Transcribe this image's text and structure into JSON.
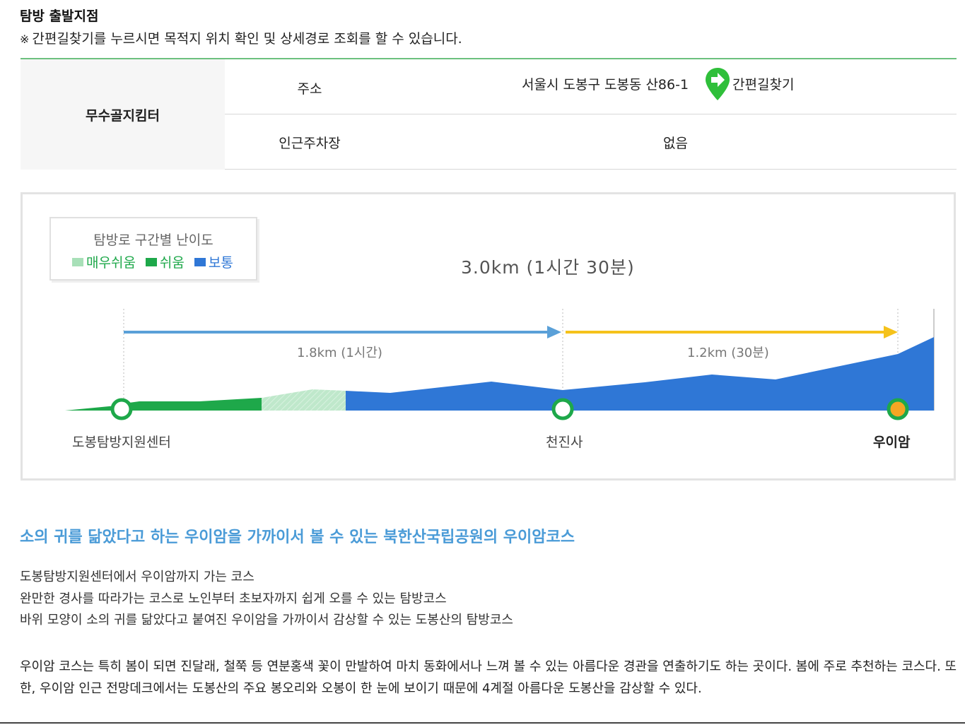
{
  "section": {
    "title": "탐방 출발지점",
    "note_mark": "※",
    "note": "간편길찾기를 누르시면 목적지 위치 확인 및 상세경로 조회를 할 수 있습니다."
  },
  "info_table": {
    "head": "무수골지킴터",
    "rows": [
      {
        "label": "주소",
        "value": "서울시 도봉구 도봉동 산86-1",
        "button": "간편길찾기"
      },
      {
        "label": "인근주차장",
        "value": "없음"
      }
    ]
  },
  "course": {
    "legend_title": "탐방로 구간별 난이도",
    "legend": [
      {
        "name": "매우쉬움",
        "color": "#a8e0b8"
      },
      {
        "name": "쉬움",
        "color": "#1ea84a"
      },
      {
        "name": "보통",
        "color": "#2f77d6"
      }
    ],
    "total": "3.0km (1시간 30분)",
    "segments": [
      {
        "label": "1.8km (1시간)",
        "color": "#5aa0d8"
      },
      {
        "label": "1.2km (30분)",
        "color": "#f5c21b"
      }
    ],
    "places": [
      "도봉탐방지원센터",
      "천진사",
      "우이암"
    ]
  },
  "headline": "소의 귀를 닮았다고 하는 우이암을 가까이서 볼 수 있는 북한산국립공원의 우이암코스",
  "desc_lines": [
    "도봉탐방지원센터에서 우이암까지 가는 코스",
    "완만한 경사를 따라가는 코스로 노인부터 초보자까지 쉽게 오를 수 있는 탐방코스",
    "바위 모양이 소의 귀를 닮았다고 붙여진 우이암을 가까이서 감상할 수 있는 도봉산의 탐방코스"
  ],
  "paragraph": "우이암 코스는 특히 봄이 되면 진달래, 철쭉 등 연분홍색 꽃이 만발하여 마치 동화에서나 느껴 볼 수 있는 아름다운 경관을 연출하기도 하는 곳이다. 봄에 주로 추천하는 코스다. 또한, 우이암 인근 전망데크에서는 도봉산의 주요 봉오리와 오봉이 한 눈에 보이기 때문에 4계절 아름다운 도봉산을 감상할 수 있다.",
  "colors": {
    "accent_green": "#6cc07e",
    "headline_blue": "#4a9bd7",
    "route_pin": "#2fbf3a"
  }
}
